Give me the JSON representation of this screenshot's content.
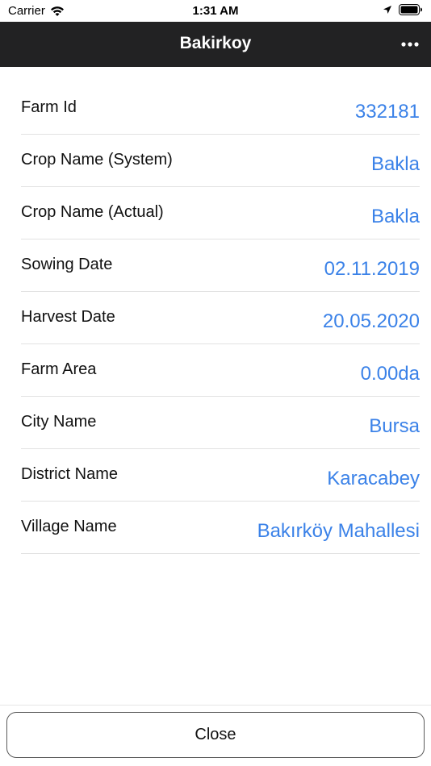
{
  "status_bar": {
    "carrier": "Carrier",
    "time": "1:31 AM",
    "icons": [
      "wifi-icon",
      "location-arrow-icon",
      "battery-icon"
    ]
  },
  "nav": {
    "title": "Bakirkoy",
    "more_icon": "more-horizontal-icon"
  },
  "rows": [
    {
      "label": "Farm Id",
      "value": "332181"
    },
    {
      "label": "Crop Name (System)",
      "value": "Bakla"
    },
    {
      "label": "Crop Name (Actual)",
      "value": "Bakla"
    },
    {
      "label": "Sowing Date",
      "value": "02.11.2019"
    },
    {
      "label": "Harvest Date",
      "value": "20.05.2020"
    },
    {
      "label": "Farm Area",
      "value": "0.00da"
    },
    {
      "label": "City Name",
      "value": "Bursa"
    },
    {
      "label": "District Name",
      "value": "Karacabey"
    },
    {
      "label": "Village Name",
      "value": "Bakırköy Mahallesi"
    }
  ],
  "close_label": "Close",
  "colors": {
    "nav_background": "#222223",
    "value_text": "#3b82e8"
  }
}
